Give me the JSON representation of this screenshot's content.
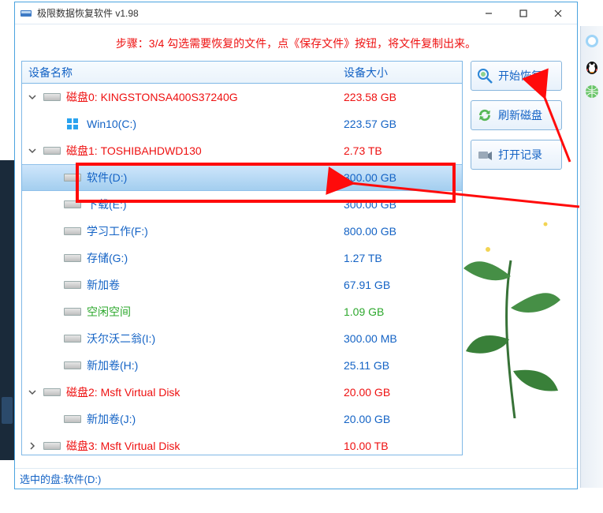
{
  "window": {
    "title": "极限数据恢复软件 v1.98"
  },
  "instruction": "步骤：3/4 勾选需要恢复的文件，点《保存文件》按钮，将文件复制出来。",
  "headers": {
    "name": "设备名称",
    "size": "设备大小"
  },
  "rows": [
    {
      "type": "disk",
      "expand": true,
      "label": "磁盘0: KINGSTONSA400S37240G",
      "size": "223.58 GB"
    },
    {
      "type": "vol-win",
      "label": "Win10(C:)",
      "size": "223.57 GB"
    },
    {
      "type": "disk",
      "expand": true,
      "label": "磁盘1: TOSHIBAHDWD130",
      "size": "2.73 TB"
    },
    {
      "type": "vol",
      "selected": true,
      "label": "软件(D:)",
      "size": "300.00 GB"
    },
    {
      "type": "vol",
      "label": "下载(E:)",
      "size": "300.00 GB"
    },
    {
      "type": "vol",
      "label": "学习工作(F:)",
      "size": "800.00 GB"
    },
    {
      "type": "vol",
      "label": "存储(G:)",
      "size": "1.27 TB"
    },
    {
      "type": "vol",
      "label": "新加卷",
      "size": "67.91 GB"
    },
    {
      "type": "vol-free",
      "label": "空闲空间",
      "size": "1.09 GB"
    },
    {
      "type": "vol",
      "label": "沃尔沃二翁(I:)",
      "size": "300.00 MB"
    },
    {
      "type": "vol",
      "label": "新加卷(H:)",
      "size": "25.11 GB"
    },
    {
      "type": "disk",
      "expand": true,
      "label": "磁盘2: Msft     Virtual Disk",
      "size": "20.00 GB"
    },
    {
      "type": "vol",
      "label": "新加卷(J:)",
      "size": "20.00 GB"
    },
    {
      "type": "disk",
      "expand": false,
      "label": "磁盘3: Msft     Virtual Disk",
      "size": "10.00 TB"
    }
  ],
  "buttons": {
    "start": "开始恢复",
    "refresh": "刷新磁盘",
    "open_log": "打开记录"
  },
  "status": {
    "prefix": "选中的盘: ",
    "value": "软件(D:)"
  }
}
